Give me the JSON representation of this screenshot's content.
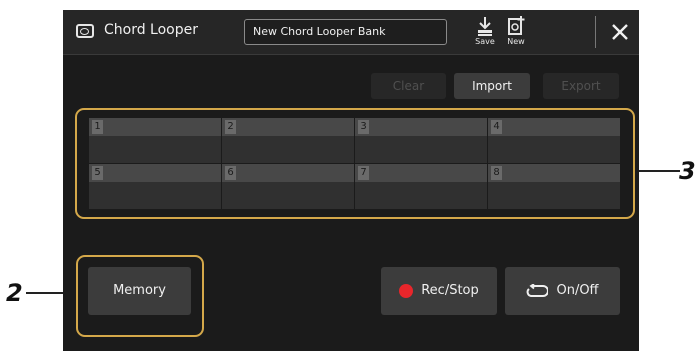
{
  "window": {
    "title": "Chord Looper",
    "bank_name": "New Chord Looper Bank",
    "save_label": "Save",
    "new_label": "New"
  },
  "actions": {
    "clear_label": "Clear",
    "import_label": "Import",
    "export_label": "Export"
  },
  "slots": [
    {
      "number": "1"
    },
    {
      "number": "2"
    },
    {
      "number": "3"
    },
    {
      "number": "4"
    },
    {
      "number": "5"
    },
    {
      "number": "6"
    },
    {
      "number": "7"
    },
    {
      "number": "8"
    }
  ],
  "bottom": {
    "memory_label": "Memory",
    "rec_stop_label": "Rec/Stop",
    "on_off_label": "On/Off"
  },
  "callouts": {
    "memory_callout": "2",
    "grid_callout": "3"
  },
  "colors": {
    "highlight_frame": "#d4a84a",
    "record_dot": "#e8262b",
    "background": "#1b1b1b"
  },
  "icons": [
    "app-icon",
    "save-icon",
    "new-icon",
    "close-icon",
    "record-dot-icon",
    "loop-icon"
  ]
}
